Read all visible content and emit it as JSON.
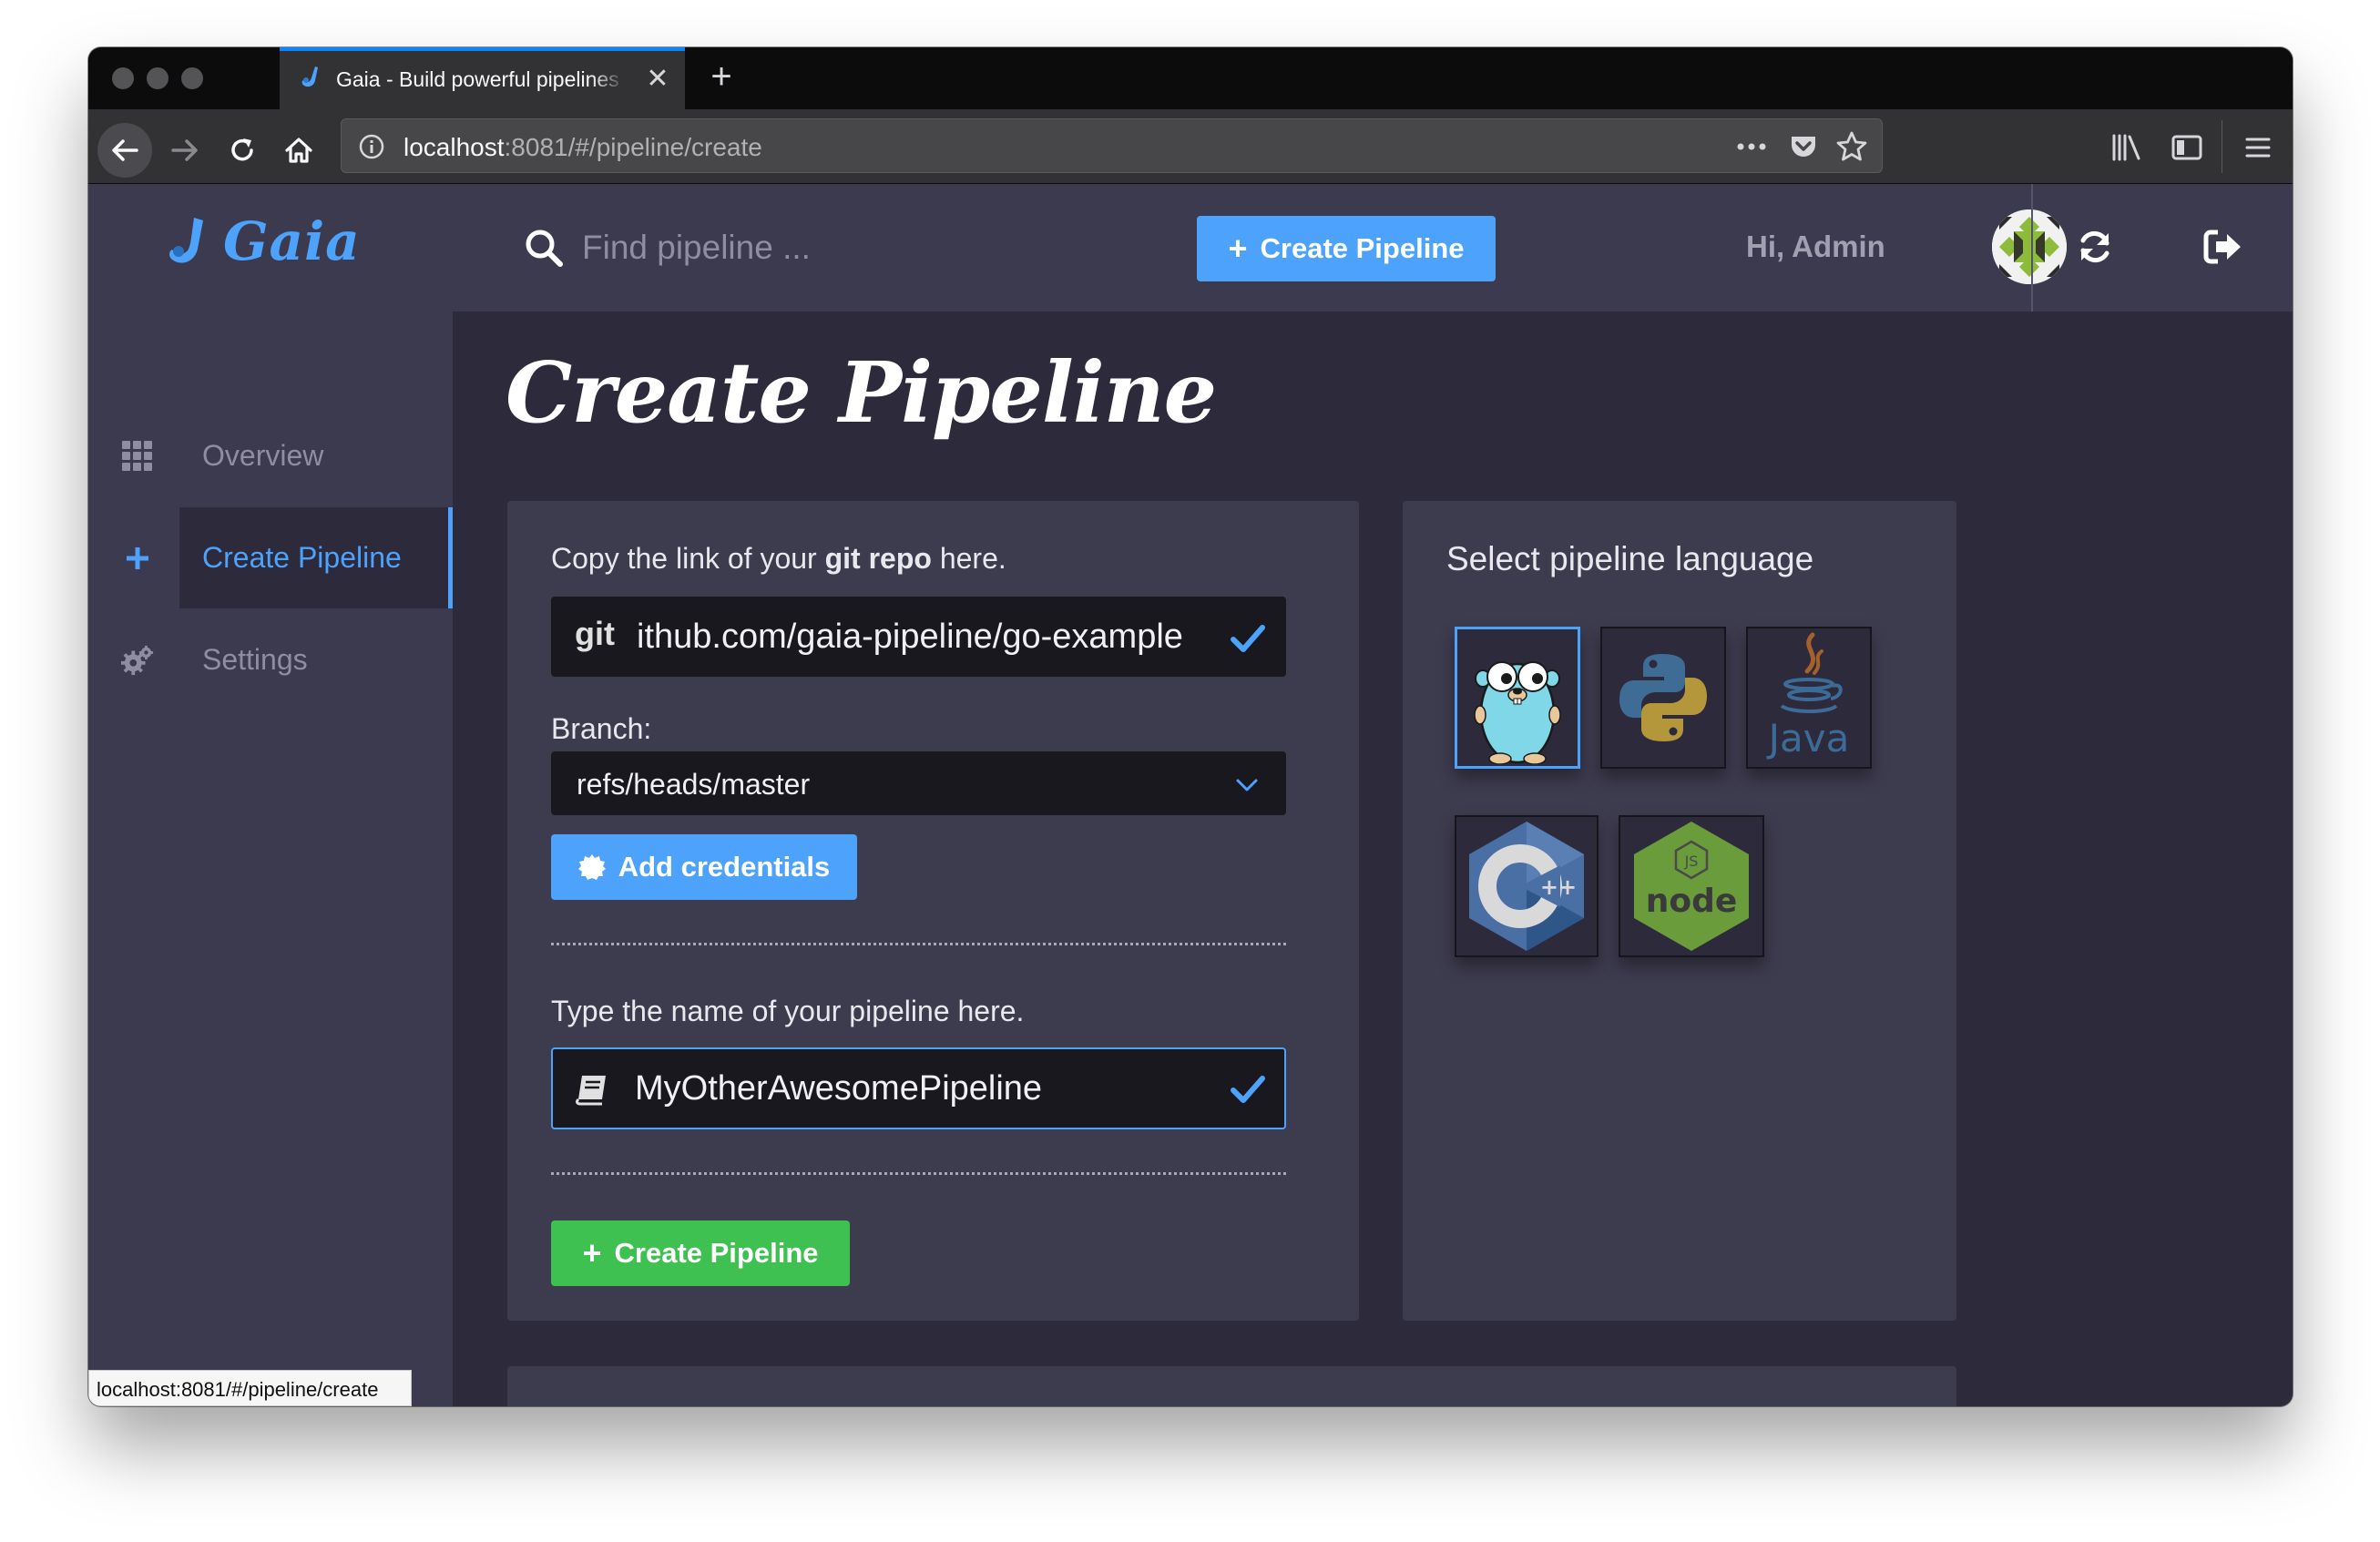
{
  "browser": {
    "tab_title": "Gaia - Build powerful pipelines",
    "url_host": "localhost",
    "url_path": ":8081/#/pipeline/create",
    "status_url": "localhost:8081/#/pipeline/create"
  },
  "sidebar": {
    "logo": "Gaia",
    "items": [
      {
        "label": "Overview",
        "icon": "grid-icon"
      },
      {
        "label": "Create Pipeline",
        "icon": "plus-icon",
        "active": true
      },
      {
        "label": "Settings",
        "icon": "gears-icon"
      }
    ]
  },
  "topbar": {
    "search_placeholder": "Find pipeline ...",
    "create_button": "Create Pipeline",
    "greeting": "Hi, Admin"
  },
  "page": {
    "title": "Create Pipeline",
    "repo_label_pre": "Copy the link of your ",
    "repo_label_bold": "git repo",
    "repo_label_post": " here.",
    "repo_prefix": "git",
    "repo_value": "ithub.com/gaia-pipeline/go-example",
    "branch_label": "Branch:",
    "branch_value": "refs/heads/master",
    "credentials_button": "Add credentials",
    "name_label": "Type the name of your pipeline here.",
    "name_value": "MyOtherAwesomePipeline",
    "submit_button": "Create Pipeline"
  },
  "languages": {
    "title": "Select pipeline language",
    "selected": "Go",
    "options": [
      {
        "name": "Go",
        "icon": "go-gopher-icon"
      },
      {
        "name": "Python",
        "icon": "python-icon"
      },
      {
        "name": "Java",
        "icon": "java-icon",
        "text": "Java"
      },
      {
        "name": "C++",
        "icon": "cpp-icon",
        "text": "++"
      },
      {
        "name": "Node.js",
        "icon": "nodejs-icon",
        "text": "node"
      }
    ]
  },
  "colors": {
    "accent": "#4da2fc",
    "success": "#3fc152",
    "sidebar": "#3c3a4e",
    "background": "#2c2a3b",
    "card": "#3d3b4e",
    "input": "#19181f"
  }
}
